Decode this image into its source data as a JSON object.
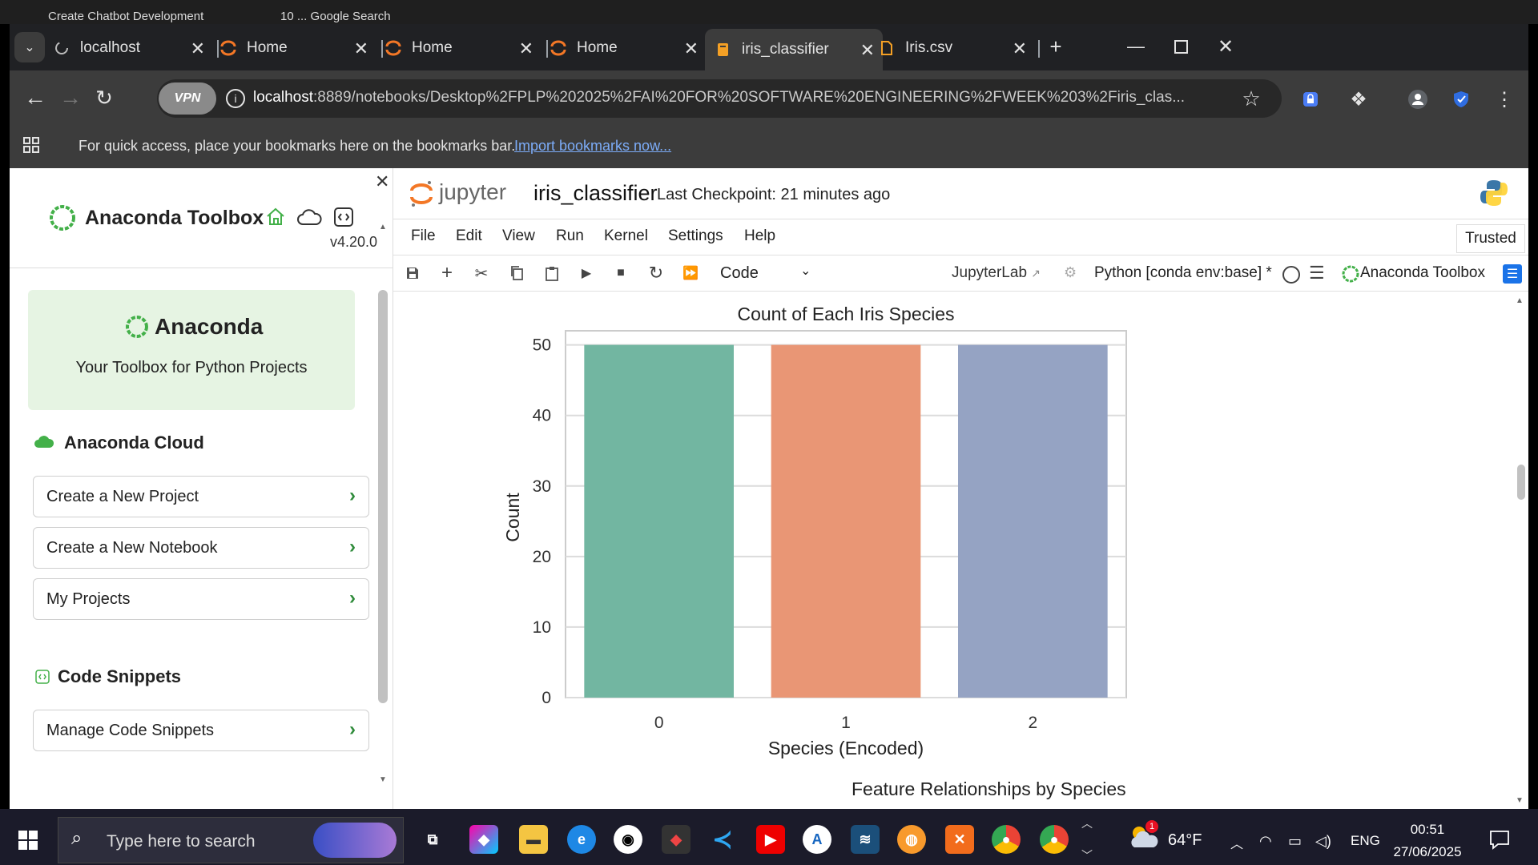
{
  "behind_tabs": [
    "Create Chatbot Development",
    "10 ... Google Search"
  ],
  "tabs": [
    {
      "label": "localhost",
      "icon": "loading-icon"
    },
    {
      "label": "Home",
      "icon": "jupyter-icon"
    },
    {
      "label": "Home",
      "icon": "jupyter-icon"
    },
    {
      "label": "Home",
      "icon": "jupyter-icon"
    },
    {
      "label": "iris_classifier",
      "icon": "notebook-icon",
      "active": true
    },
    {
      "label": "Iris.csv",
      "icon": "file-icon"
    }
  ],
  "address": {
    "vpn": "VPN",
    "host": "localhost",
    "path": ":8889/notebooks/Desktop%2FPLP%202025%2FAI%20FOR%20SOFTWARE%20ENGINEERING%2FWEEK%203%2Firis_clas..."
  },
  "bookmarks": {
    "text": "For quick access, place your bookmarks here on the bookmarks bar.",
    "link": "Import bookmarks now..."
  },
  "sidebar": {
    "title": "Anaconda Toolbox",
    "version": "v4.20.0",
    "card_title": "Anaconda",
    "card_subtitle": "Your Toolbox for Python Projects",
    "cloud_heading": "Anaconda Cloud",
    "cloud_items": [
      "Create a New Project",
      "Create a New Notebook",
      "My Projects"
    ],
    "snippets_heading": "Code Snippets",
    "snippet_items": [
      "Manage Code Snippets"
    ]
  },
  "jupyter": {
    "logo": "jupyter",
    "notebook_name": "iris_classifier",
    "checkpoint": "Last Checkpoint: 21 minutes ago",
    "menus": [
      "File",
      "Edit",
      "View",
      "Run",
      "Kernel",
      "Settings",
      "Help"
    ],
    "trusted": "Trusted",
    "cell_type": "Code",
    "jupyterlab_link": "JupyterLab",
    "kernel": "Python [conda env:base] *",
    "anaconda_toolbox": "Anaconda Toolbox",
    "next_heading": "Feature Relationships by Species"
  },
  "chart_data": {
    "type": "bar",
    "title": "Count of Each Iris Species",
    "xlabel": "Species (Encoded)",
    "ylabel": "Count",
    "categories": [
      "0",
      "1",
      "2"
    ],
    "values": [
      50,
      50,
      50
    ],
    "colors": [
      "#72b6a1",
      "#e99675",
      "#95a3c3"
    ],
    "ylim": [
      0,
      52
    ],
    "yticks": [
      0,
      10,
      20,
      30,
      40,
      50
    ],
    "grid": true
  },
  "taskbar": {
    "search_placeholder": "Type here to search",
    "weather": "64°F",
    "weather_badge": "1",
    "language": "ENG",
    "time": "00:51",
    "date": "27/06/2025"
  },
  "colors": {
    "jupyter_orange": "#f37726",
    "anaconda_green": "#43b049",
    "tab_bar": "#202124"
  }
}
